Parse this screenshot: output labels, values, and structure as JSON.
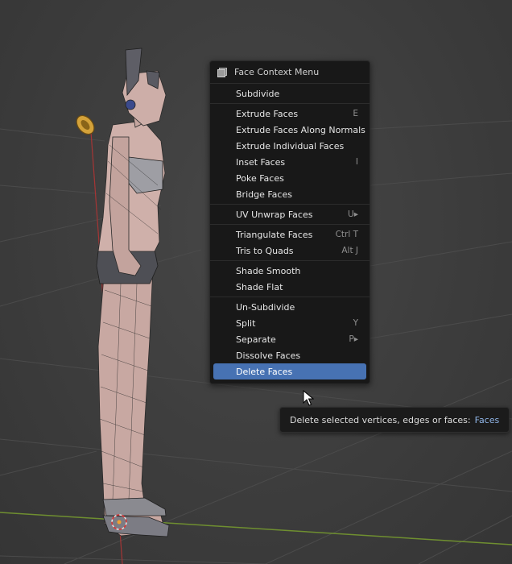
{
  "viewport": {
    "background": "#3d3d3d",
    "grid_color": "#4a4a4a",
    "x_axis_color": "#7a9a38",
    "z_axis_color": "#b43a3a",
    "mesh_fill": "#c9a9a3",
    "wire_color": "#2a2a2a"
  },
  "menu": {
    "title": "Face Context Menu",
    "sections": [
      {
        "items": [
          {
            "label": "Subdivide",
            "shortcut": ""
          }
        ]
      },
      {
        "items": [
          {
            "label": "Extrude Faces",
            "shortcut": "E"
          },
          {
            "label": "Extrude Faces Along Normals",
            "shortcut": ""
          },
          {
            "label": "Extrude Individual Faces",
            "shortcut": ""
          },
          {
            "label": "Inset Faces",
            "shortcut": "I"
          },
          {
            "label": "Poke Faces",
            "shortcut": ""
          },
          {
            "label": "Bridge Faces",
            "shortcut": ""
          }
        ]
      },
      {
        "items": [
          {
            "label": "UV Unwrap Faces",
            "shortcut": "U▸"
          }
        ]
      },
      {
        "items": [
          {
            "label": "Triangulate Faces",
            "shortcut": "Ctrl T"
          },
          {
            "label": "Tris to Quads",
            "shortcut": "Alt J"
          }
        ]
      },
      {
        "items": [
          {
            "label": "Shade Smooth",
            "shortcut": ""
          },
          {
            "label": "Shade Flat",
            "shortcut": ""
          }
        ]
      },
      {
        "items": [
          {
            "label": "Un-Subdivide",
            "shortcut": ""
          },
          {
            "label": "Split",
            "shortcut": "Y"
          },
          {
            "label": "Separate",
            "shortcut": "P▸"
          },
          {
            "label": "Dissolve Faces",
            "shortcut": ""
          },
          {
            "label": "Delete Faces",
            "shortcut": "",
            "highlighted": true
          }
        ]
      }
    ]
  },
  "tooltip": {
    "description": "Delete selected vertices, edges or faces:",
    "python": "Faces"
  },
  "colors": {
    "highlight": "#4772b3",
    "menu_bg": "#181818"
  }
}
